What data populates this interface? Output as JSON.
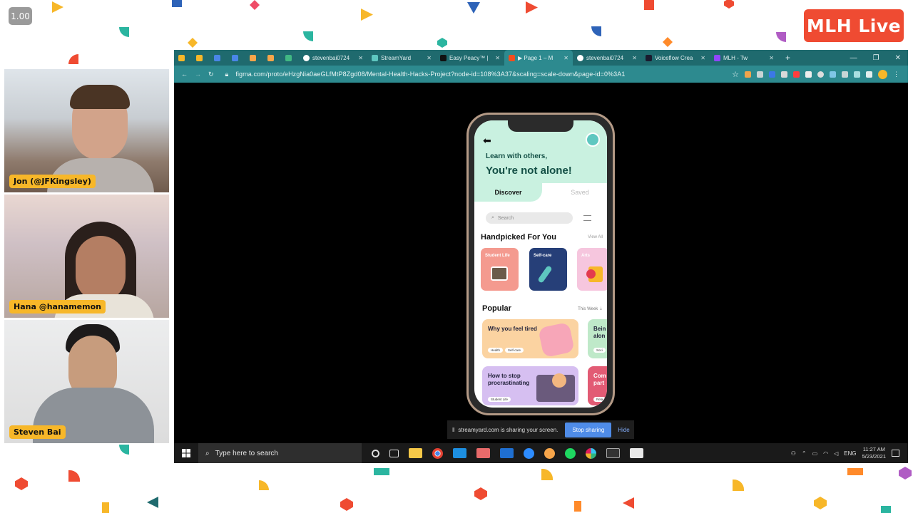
{
  "zoom_level": "1.00",
  "brand": {
    "logo_text": "MLH Live",
    "accent": "#ef4b32"
  },
  "participants": [
    {
      "name": "Jon (@JFKingsley)"
    },
    {
      "name": "Hana @hanamemon"
    },
    {
      "name": "Steven Bai"
    }
  ],
  "browser": {
    "tabs": [
      {
        "label": "",
        "icon": "star-icon"
      },
      {
        "label": "",
        "icon": "star-icon"
      },
      {
        "label": "",
        "icon": "app-icon"
      },
      {
        "label": "",
        "icon": "app-icon"
      },
      {
        "label": "",
        "icon": "chart-icon"
      },
      {
        "label": "",
        "icon": "chart-icon"
      },
      {
        "label": "",
        "icon": "vue-icon"
      },
      {
        "label": "stevenbai0724",
        "icon": "github-icon"
      },
      {
        "label": "StreamYard",
        "icon": "streamyard-icon"
      },
      {
        "label": "Easy Peacy™ |",
        "icon": "d-icon"
      },
      {
        "label": "▶ Page 1 – M",
        "icon": "figma-icon",
        "active": true
      },
      {
        "label": "stevenbai0724",
        "icon": "github-icon"
      },
      {
        "label": "Voiceflow Crea",
        "icon": "voiceflow-icon"
      },
      {
        "label": "MLH - Tw",
        "icon": "twitch-icon"
      }
    ],
    "new_tab": "+",
    "url": "figma.com/proto/eHzgNia0aeGLfMtP8Zgd08/Mental-Health-Hacks-Project?node-id=108%3A37&scaling=scale-down&page-id=0%3A1"
  },
  "app": {
    "subtitle": "Learn with others,",
    "title": "You're not alone!",
    "tab_discover": "Discover",
    "tab_saved": "Saved",
    "search_placeholder": "Search",
    "handpicked_heading": "Handpicked For You",
    "view_all": "View All",
    "cards": [
      {
        "label": "Student Life",
        "color": "#f49a8f"
      },
      {
        "label": "Self-care",
        "color": "#263f78"
      },
      {
        "label": "Arts",
        "color": "#f6c6de"
      }
    ],
    "popular_heading": "Popular",
    "this_week": "This Week",
    "popular": [
      {
        "title": "Why you feel tired",
        "tags": [
          "Health",
          "Self-care"
        ],
        "color": "#fbd3a1"
      },
      {
        "title": "Bein alon",
        "tags": [
          "Soci"
        ],
        "color": "#bfe9c9"
      },
      {
        "title": "How to stop procrastinating",
        "tags": [
          "Student Life"
        ],
        "color": "#d6bff1"
      },
      {
        "title": "Com part",
        "tags": [
          "Rela"
        ],
        "color": "#e25b74"
      }
    ]
  },
  "share_bar": {
    "message": "streamyard.com is sharing your screen.",
    "stop": "Stop sharing",
    "hide": "Hide"
  },
  "taskbar": {
    "search_placeholder": "Type here to search",
    "language": "ENG",
    "time": "11:27 AM",
    "date": "5/23/2021"
  }
}
